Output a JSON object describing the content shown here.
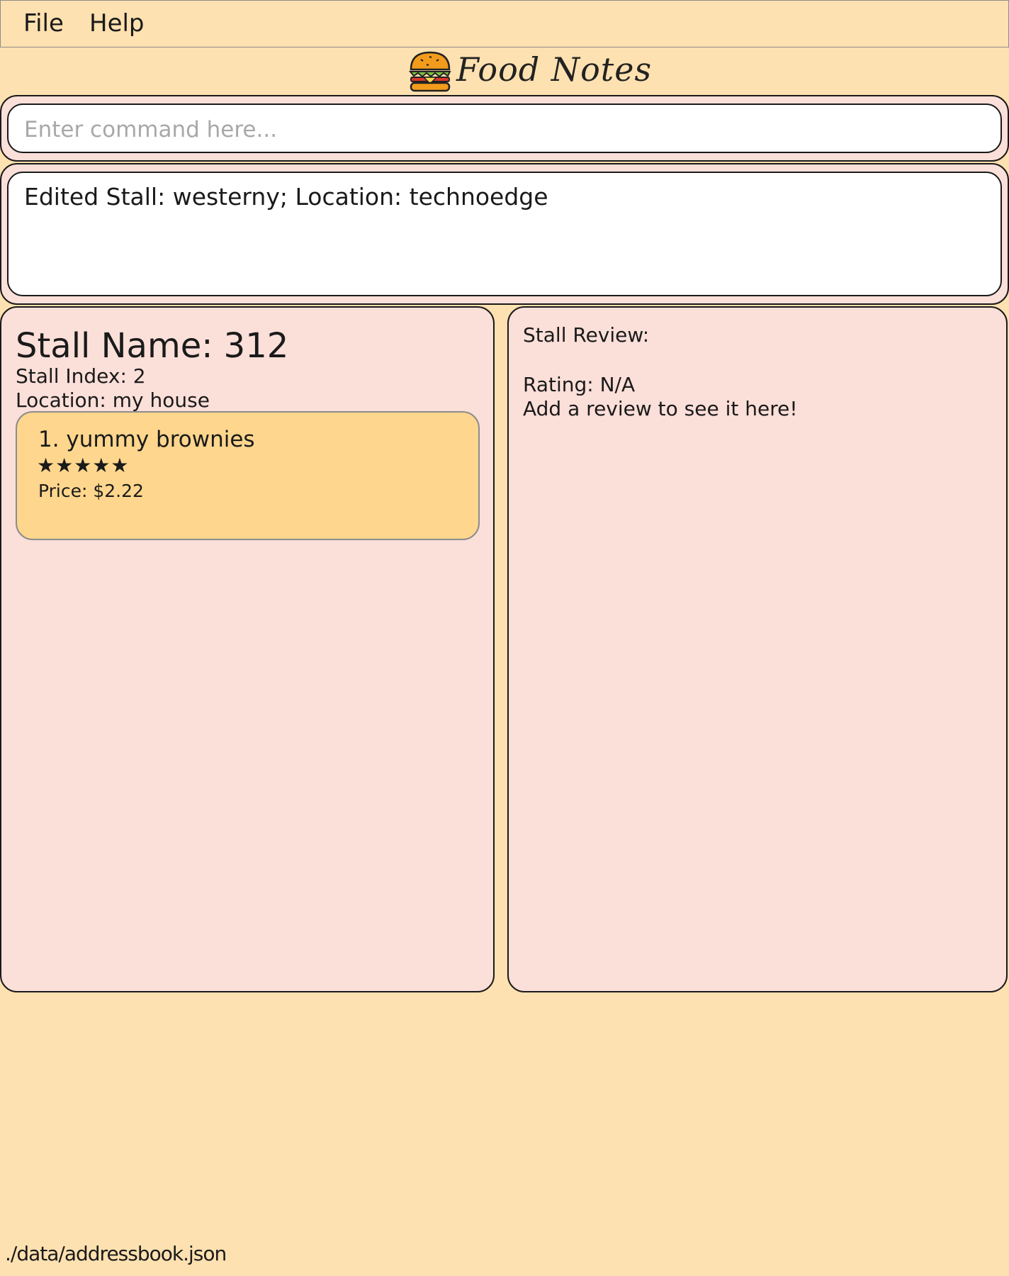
{
  "menu": {
    "file_label": "File",
    "help_label": "Help"
  },
  "header": {
    "title": "Food Notes",
    "logo_icon": "burger-icon"
  },
  "command_box": {
    "placeholder": "Enter command here...",
    "value": ""
  },
  "result_display": {
    "text": "Edited Stall: westerny; Location: technoedge"
  },
  "stall_details": {
    "name": "Stall Name: 312",
    "index": "Stall Index: 2",
    "location": "Location: my house",
    "foods": [
      {
        "name": "1.  yummy brownies",
        "stars": "★★★★★",
        "rating": 5,
        "price": "Price: $2.22"
      }
    ]
  },
  "review_panel": {
    "heading": "Stall Review:",
    "rating": "Rating: N/A",
    "message": "Add a review to see it here!"
  },
  "status_bar": {
    "path": "./data/addressbook.json"
  },
  "colors": {
    "background": "#FEE1B0",
    "panel": "#FBDFD9",
    "food_card": "#FFD68D",
    "border": "#1a1a1a"
  }
}
